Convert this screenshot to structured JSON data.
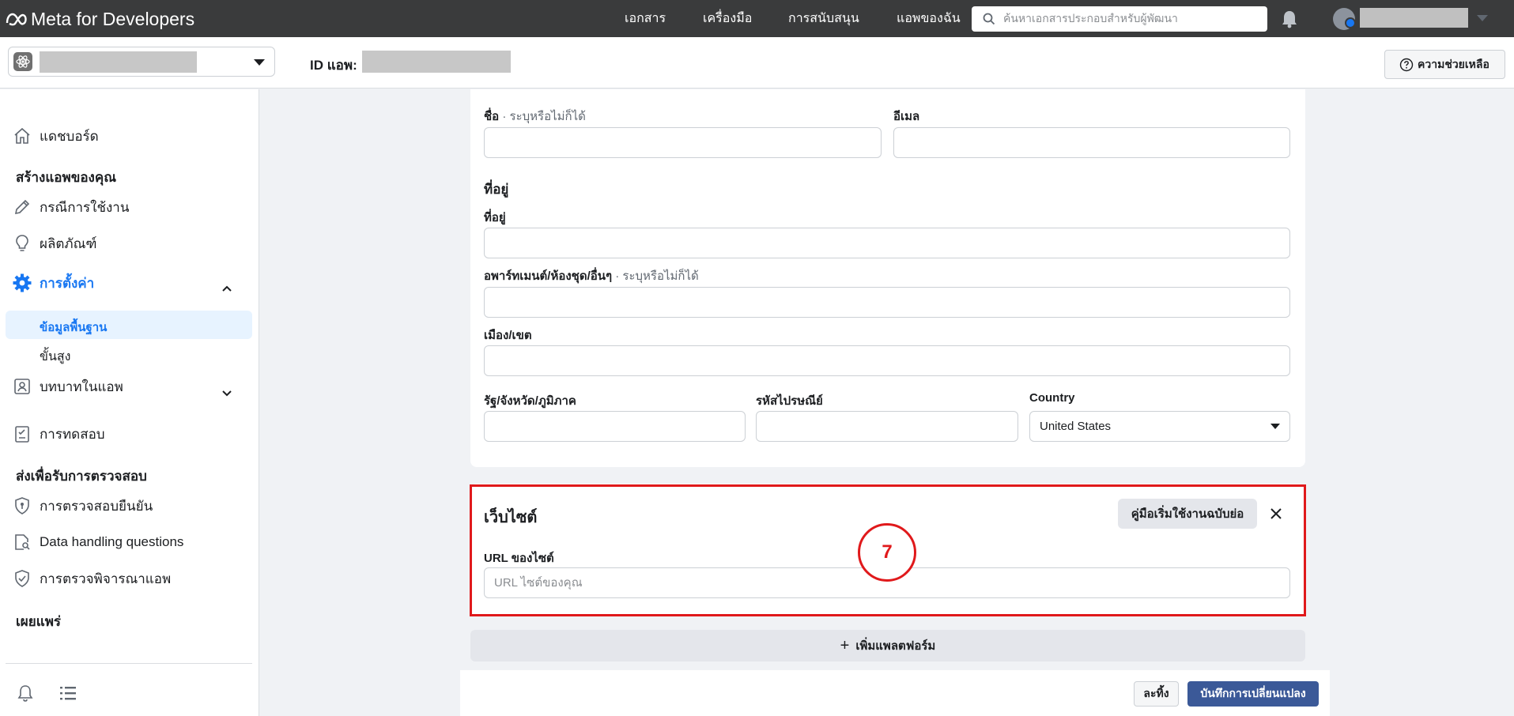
{
  "topbar": {
    "brand": "Meta for Developers",
    "nav": [
      "เอกสาร",
      "เครื่องมือ",
      "การสนับสนุน",
      "แอพของฉัน"
    ],
    "search_placeholder": "ค้นหาเอกสารประกอบสำหรับผู้พัฒนา"
  },
  "subheader": {
    "app_id_label": "ID แอพ:",
    "help_label": "ความช่วยเหลือ"
  },
  "sidebar": {
    "dashboard": "แดชบอร์ด",
    "build_heading": "สร้างแอพของคุณ",
    "use_cases": "กรณีการใช้งาน",
    "products": "ผลิตภัณฑ์",
    "settings": "การตั้งค่า",
    "settings_basic": "ข้อมูลพื้นฐาน",
    "settings_advanced": "ขั้นสูง",
    "app_roles": "บทบาทในแอพ",
    "testing": "การทดสอบ",
    "review_heading": "ส่งเพื่อรับการตรวจสอบ",
    "verification": "การตรวจสอบยืนยัน",
    "data_handling": "Data handling questions",
    "app_review": "การตรวจพิจารณาแอพ",
    "publish_heading": "เผยแพร่"
  },
  "contact_form": {
    "name_label": "ชื่อ",
    "optional": " · ระบุหรือไม่ก็ได้",
    "email_label": "อีเมล",
    "address_heading": "ที่อยู่",
    "street_label": "ที่อยู่",
    "apartment_label": "อพาร์ทเมนต์/ห้องชุด/อื่นๆ",
    "city_label": "เมือง/เขต",
    "state_label": "รัฐ/จังหวัด/ภูมิภาค",
    "zip_label": "รหัสไปรษณีย์",
    "country_label": "Country",
    "country_value": "United States"
  },
  "website": {
    "title": "เว็บไซต์",
    "quickstart_label": "คู่มือเริ่มใช้งานฉบับย่อ",
    "url_label": "URL ของไซต์",
    "url_placeholder": "URL ไซต์ของคุณ",
    "step_number": "7"
  },
  "add_platform_label": "เพิ่มแพลตฟอร์ม",
  "footer": {
    "cancel_label": "ละทิ้ง",
    "save_label": "บันทึกการเปลี่ยนแปลง"
  }
}
